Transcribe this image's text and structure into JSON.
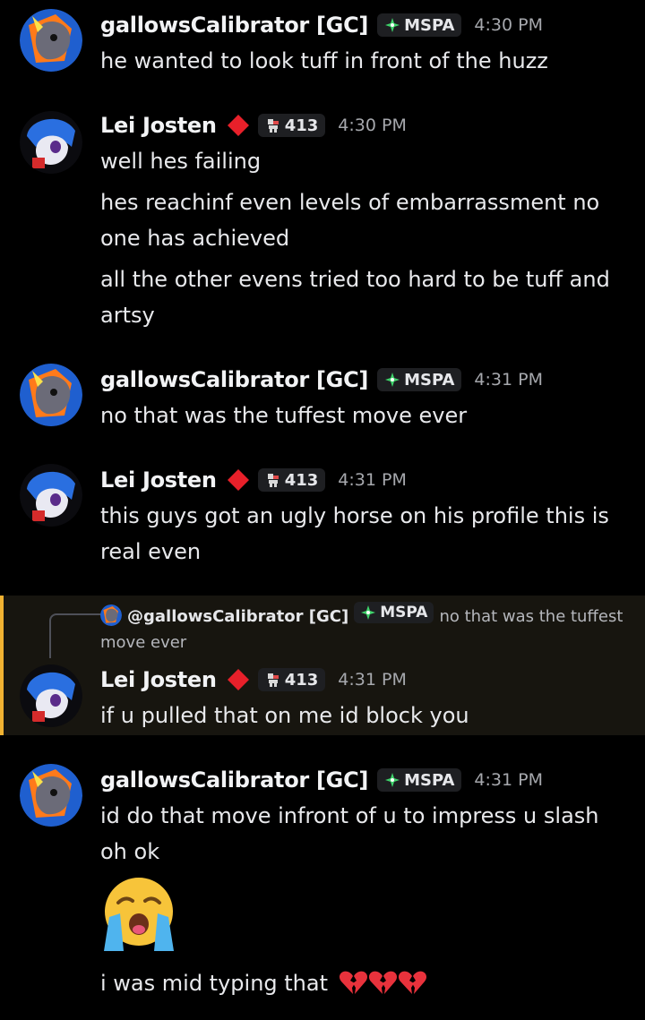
{
  "users": {
    "gc": {
      "name": "gallowsCalibrator [GC]",
      "tag": "MSPA"
    },
    "lei": {
      "name": "Lei Josten",
      "tag": "413"
    }
  },
  "messages": [
    {
      "time": "4:30 PM",
      "lines": [
        "he wanted to look tuff in front of the huzz"
      ]
    },
    {
      "time": "4:30 PM",
      "lines": [
        "well hes failing",
        "hes reachinf even levels of embarrassment no",
        "one has achieved",
        "all the other evens tried too hard to be tuff and",
        "artsy"
      ]
    },
    {
      "time": "4:31 PM",
      "lines": [
        "no that was the tuffest move ever"
      ]
    },
    {
      "time": "4:31 PM",
      "lines": [
        "this guys got an ugly horse on his profile this is",
        "real even"
      ]
    },
    {
      "time": "4:31 PM",
      "lines": [
        "if u pulled that on me id block you"
      ]
    },
    {
      "time": "4:31 PM",
      "lines": [
        "id do that move infront of u to impress u slash",
        "oh ok",
        "i was mid typing that"
      ]
    }
  ],
  "reply": {
    "mention": "@gallowsCalibrator [GC]",
    "tag": "MSPA",
    "text_a": "no that was the tuffest",
    "text_b": "move ever"
  },
  "colors": {
    "accent": "#f0b232",
    "tag_bg": "#1e1f22",
    "diamond": "#e8202a",
    "highlight": "#17150f"
  }
}
